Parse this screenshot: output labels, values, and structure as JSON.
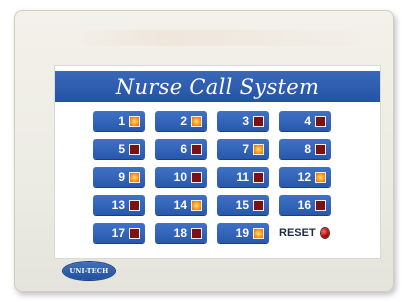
{
  "title": "Nurse Call System",
  "buttons": [
    {
      "num": "1",
      "lit": true
    },
    {
      "num": "2",
      "lit": true
    },
    {
      "num": "3",
      "lit": false
    },
    {
      "num": "4",
      "lit": false
    },
    {
      "num": "5",
      "lit": false
    },
    {
      "num": "6",
      "lit": false
    },
    {
      "num": "7",
      "lit": true
    },
    {
      "num": "8",
      "lit": false
    },
    {
      "num": "9",
      "lit": true
    },
    {
      "num": "10",
      "lit": false
    },
    {
      "num": "11",
      "lit": false
    },
    {
      "num": "12",
      "lit": true
    },
    {
      "num": "13",
      "lit": false
    },
    {
      "num": "14",
      "lit": true
    },
    {
      "num": "15",
      "lit": false
    },
    {
      "num": "16",
      "lit": false
    },
    {
      "num": "17",
      "lit": false
    },
    {
      "num": "18",
      "lit": false
    },
    {
      "num": "19",
      "lit": true
    }
  ],
  "reset_label": "RESET",
  "brand": "UNI-TECH",
  "colors": {
    "button_blue": "#2f63b6",
    "lamp_on": "#ff9a1f",
    "lamp_off": "#7a1212",
    "reset_led": "#c40000"
  }
}
